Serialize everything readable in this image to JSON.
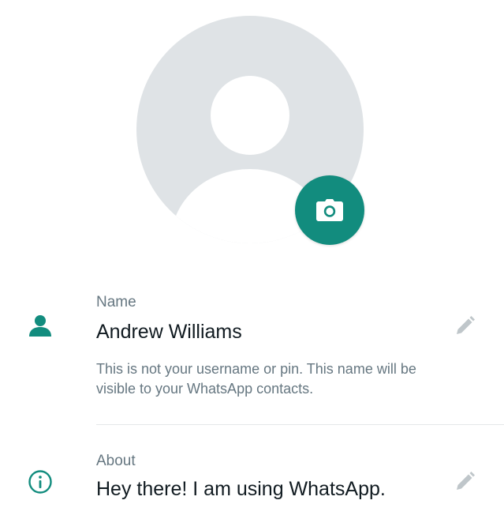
{
  "profile": {
    "camera_icon": "camera-icon"
  },
  "name_section": {
    "icon": "person-icon",
    "label": "Name",
    "value": "Andrew Williams",
    "hint": "This is not your username or pin. This name will be visible to your WhatsApp contacts.",
    "edit_icon": "pencil-icon"
  },
  "about_section": {
    "icon": "info-icon",
    "label": "About",
    "value": "Hey there! I am using WhatsApp.",
    "edit_icon": "pencil-icon"
  },
  "colors": {
    "accent": "#128c7e",
    "avatar_bg": "#dfe3e6",
    "primary_text": "#111b21",
    "secondary_text": "#667781",
    "icon_muted": "#bfc6ca"
  }
}
